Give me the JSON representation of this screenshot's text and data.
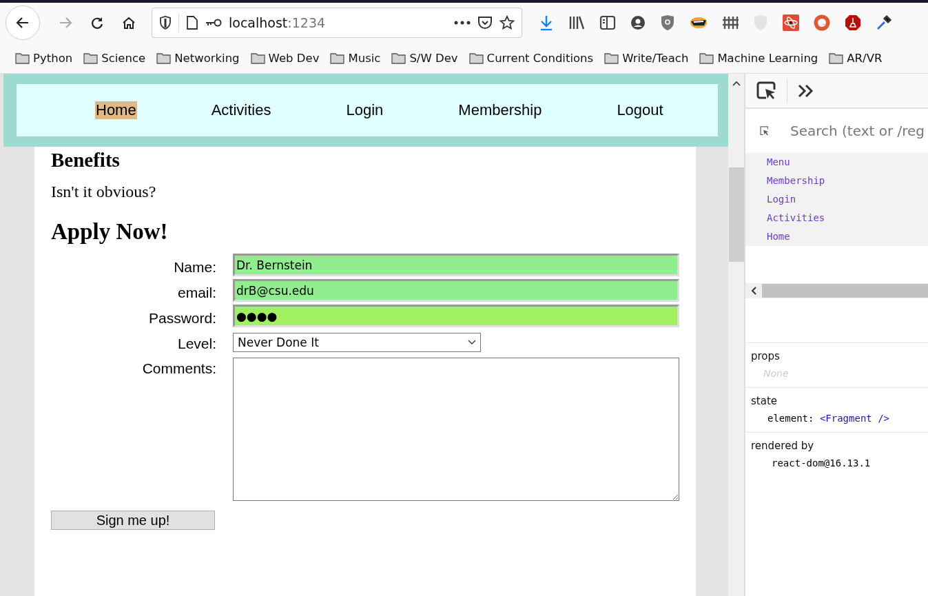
{
  "browser": {
    "address_host": "localhost",
    "address_port": ":1234",
    "bookmarks": [
      "Python",
      "Science",
      "Networking",
      "Web Dev",
      "Music",
      "S/W Dev",
      "Current Conditions",
      "Write/Teach",
      "Machine Learning",
      "AR/VR"
    ]
  },
  "nav": [
    {
      "label": "Home",
      "selected": true
    },
    {
      "label": "Activities",
      "selected": false
    },
    {
      "label": "Login",
      "selected": false
    },
    {
      "label": "Membership",
      "selected": false
    },
    {
      "label": "Logout",
      "selected": false
    }
  ],
  "page": {
    "heading": "Benefits",
    "text": "Isn't it obvious?",
    "form_title": "Apply Now!",
    "fields": [
      {
        "kind": "text",
        "label": "Name:",
        "value": "Dr. Bernstein",
        "valid": true
      },
      {
        "kind": "text",
        "label": "email:",
        "value": "drB@csu.edu",
        "valid": true
      },
      {
        "kind": "password",
        "label": "Password:",
        "value": "●●●●",
        "valid": true
      },
      {
        "kind": "select",
        "label": "Level:",
        "value": "Never Done It"
      },
      {
        "kind": "textarea",
        "label": "Comments:"
      }
    ],
    "submit": "Sign me up!"
  },
  "devtools": {
    "search_placeholder": "Search (text or /reg",
    "tree": [
      "Menu",
      "Membership",
      "Login",
      "Activities",
      "Home"
    ],
    "props_title": "props",
    "props_empty": "None",
    "state_title": "state",
    "state_key": "element:",
    "state_value": "<Fragment />",
    "rendered_title": "rendered by",
    "rendered_value": "react-dom@16.13.1"
  }
}
